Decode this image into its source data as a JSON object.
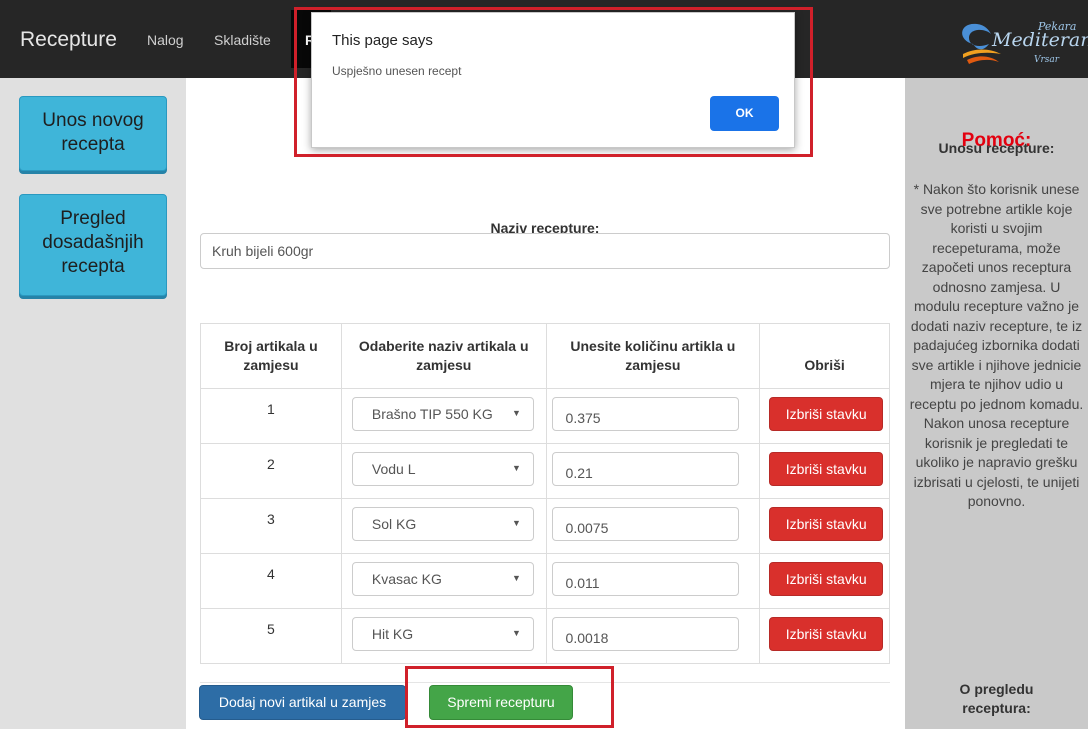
{
  "navbar": {
    "brand": "Recepture",
    "links": [
      "Nalog",
      "Skladište"
    ],
    "active_fragment": "R"
  },
  "logo": {
    "line1": "Pekara",
    "line2": "Mediteran",
    "line3": "Vrsar"
  },
  "left_sidebar": {
    "buttons": [
      {
        "label": "Unos novog recepta"
      },
      {
        "label": "Pregled dosadašnjih recepta"
      }
    ]
  },
  "right_sidebar": {
    "title": "Pomoć:",
    "subtitle": "Unosu recepture:",
    "text": "* Nakon što korisnik unese sve potrebne artikle koje koristi u svojim recepeturama, može započeti unos receptura odnosno zamjesa. U modulu recepture važno je dodati naziv recepture, te iz padajućeg izbornika dodati sve artikle i njihove jednicie mjera te njihov udio u receptu po jednom komadu. Nakon unosa recepture korisnik je pregledati te ukoliko je napravio grešku izbrisati u cjelosti, te unijeti ponovno.",
    "subtitle2": "O pregledu receptura:"
  },
  "form": {
    "recipe_label": "Naziv recepture:",
    "recipe_value": "Kruh bijeli 600gr"
  },
  "table": {
    "headers": [
      "Broj artikala u zamjesu",
      "Odaberite naziv artikala u zamjesu",
      "Unesite količinu artikla u zamjesu",
      "Obriši"
    ],
    "rows": [
      {
        "num": "1",
        "article": "Brašno TIP 550 KG",
        "qty": "0.375",
        "delete": "Izbriši stavku"
      },
      {
        "num": "2",
        "article": "Vodu L",
        "qty": "0.21",
        "delete": "Izbriši stavku"
      },
      {
        "num": "3",
        "article": "Sol KG",
        "qty": "0.0075",
        "delete": "Izbriši stavku"
      },
      {
        "num": "4",
        "article": "Kvasac KG",
        "qty": "0.011",
        "delete": "Izbriši stavku"
      },
      {
        "num": "5",
        "article": "Hit KG",
        "qty": "0.0018",
        "delete": "Izbriši stavku"
      }
    ]
  },
  "actions": {
    "add_label": "Dodaj novi artikal u zamjes",
    "save_label": "Spremi recepturu"
  },
  "dialog": {
    "title": "This page says",
    "message": "Uspješno unesen recept",
    "ok_label": "OK"
  },
  "colors": {
    "navbar": "#262626",
    "sidebar_button": "#3fb5d9",
    "help_title": "#e3000f",
    "delete_button": "#d9302c",
    "add_button": "#2d6da6",
    "save_button": "#44a548",
    "dialog_ok": "#1a73e8",
    "highlight_frame": "#d0202a"
  }
}
